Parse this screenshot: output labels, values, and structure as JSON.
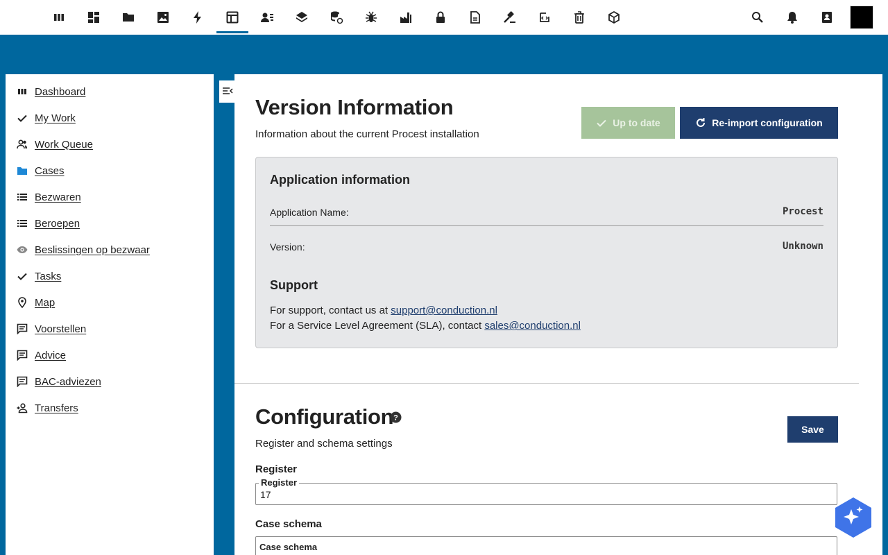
{
  "topbar": {
    "apps": [
      {
        "icon": "columns-icon"
      },
      {
        "icon": "dashboard-grid-icon"
      },
      {
        "icon": "folder-icon"
      },
      {
        "icon": "image-icon"
      },
      {
        "icon": "lightning-icon"
      },
      {
        "icon": "table-edit-icon"
      },
      {
        "icon": "contacts-icon"
      },
      {
        "icon": "layers-icon"
      },
      {
        "icon": "database-sync-icon"
      },
      {
        "icon": "bug-icon"
      },
      {
        "icon": "factory-icon"
      },
      {
        "icon": "lock-icon"
      },
      {
        "icon": "document-icon"
      },
      {
        "icon": "gavel-icon"
      },
      {
        "icon": "code-edit-icon"
      },
      {
        "icon": "trash-icon"
      },
      {
        "icon": "cube-icon"
      }
    ],
    "active_index": 5,
    "right": [
      "search-icon",
      "notifications-icon",
      "contacts-book-icon"
    ]
  },
  "sidebar": {
    "items": [
      {
        "label": "Dashboard",
        "icon": "columns-icon"
      },
      {
        "label": "My Work",
        "icon": "check-icon"
      },
      {
        "label": "Work Queue",
        "icon": "account-group-icon"
      },
      {
        "label": "Cases",
        "icon": "folder-icon"
      },
      {
        "label": "Bezwaren",
        "icon": "list-icon"
      },
      {
        "label": "Beroepen",
        "icon": "list-icon"
      },
      {
        "label": "Beslissingen op bezwaar",
        "icon": "eye-icon"
      },
      {
        "label": "Tasks",
        "icon": "check-icon"
      },
      {
        "label": "Map",
        "icon": "map-marker-icon"
      },
      {
        "label": "Voorstellen",
        "icon": "message-text-icon"
      },
      {
        "label": "Advice",
        "icon": "message-text-icon"
      },
      {
        "label": "BAC-adviezen",
        "icon": "message-text-icon"
      },
      {
        "label": "Transfers",
        "icon": "account-plus-icon"
      }
    ]
  },
  "version": {
    "title": "Version Information",
    "subtitle": "Information about the current Procest installation",
    "up_to_date_label": "Up to date",
    "reimport_label": "Re-import configuration",
    "app_info_title": "Application information",
    "rows": [
      {
        "label": "Application Name:",
        "value": "Procest"
      },
      {
        "label": "Version:",
        "value": "Unknown"
      }
    ],
    "support_title": "Support",
    "support_text": "For support, contact us at ",
    "support_email": "support@conduction.nl",
    "sla_text": "For a Service Level Agreement (SLA), contact ",
    "sla_email": "sales@conduction.nl"
  },
  "configuration": {
    "title": "Configuration",
    "subtitle": "Register and schema settings",
    "save_label": "Save",
    "register": {
      "title": "Register",
      "legend": "Register",
      "value": "17"
    },
    "case_schema": {
      "title": "Case schema",
      "legend": "Case schema",
      "value": ""
    }
  },
  "colors": {
    "brand": "#00679e",
    "primary_button": "#1f3e6e",
    "success_button": "#a6c49b",
    "assistant": "#3f74e8"
  }
}
